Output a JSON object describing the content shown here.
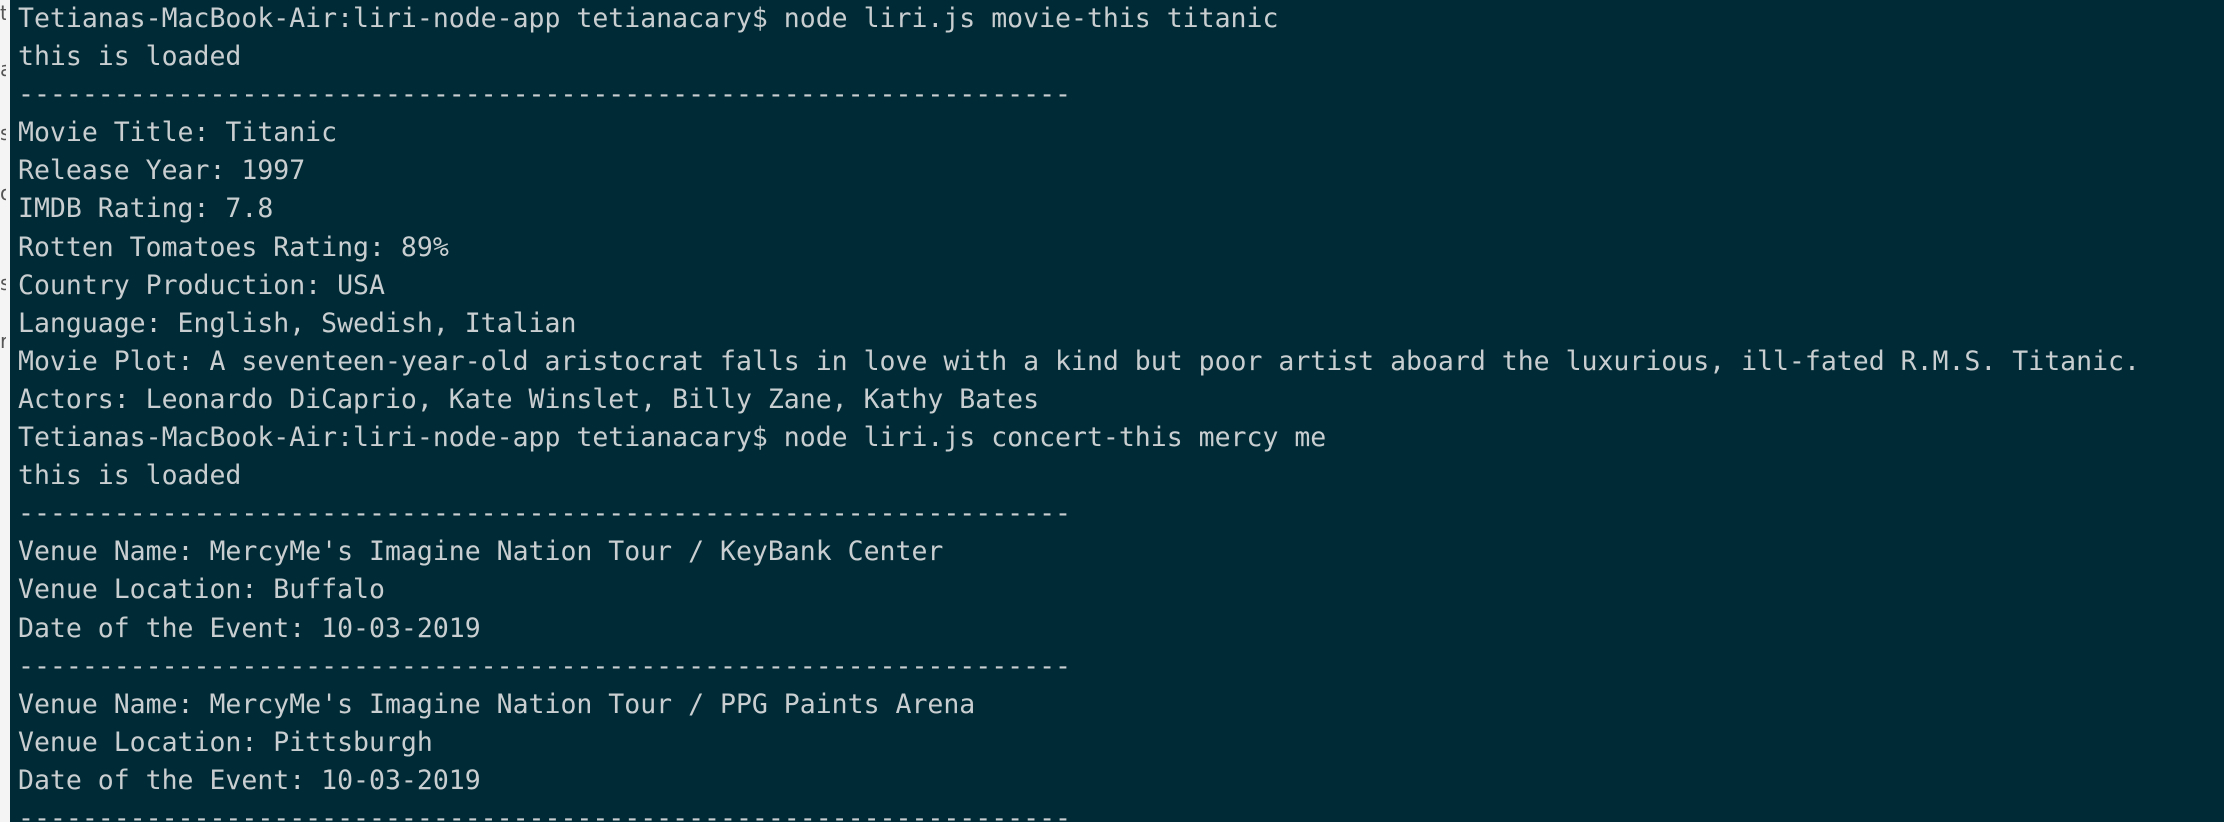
{
  "window": {
    "app": "Terminal",
    "background_color": "#002b36",
    "text_color": "#c9ced0"
  },
  "left_edge_fragments": [
    "t",
    "a",
    "s",
    "o",
    "s",
    "r"
  ],
  "terminal": {
    "lines": [
      "Tetianas-MacBook-Air:liri-node-app tetianacary$ node liri.js movie-this titanic",
      "this is loaded",
      "------------------------------------------------------------------",
      "Movie Title: Titanic",
      "Release Year: 1997",
      "IMDB Rating: 7.8",
      "Rotten Tomatoes Rating: 89%",
      "Country Production: USA",
      "Language: English, Swedish, Italian",
      "Movie Plot: A seventeen-year-old aristocrat falls in love with a kind but poor artist aboard the luxurious, ill-fated R.M.S. Titanic.",
      "Actors: Leonardo DiCaprio, Kate Winslet, Billy Zane, Kathy Bates",
      "Tetianas-MacBook-Air:liri-node-app tetianacary$ node liri.js concert-this mercy me",
      "this is loaded",
      "------------------------------------------------------------------",
      "Venue Name: MercyMe's Imagine Nation Tour / KeyBank Center",
      "Venue Location: Buffalo",
      "Date of the Event: 10-03-2019",
      "------------------------------------------------------------------",
      "Venue Name: MercyMe's Imagine Nation Tour / PPG Paints Arena",
      "Venue Location: Pittsburgh",
      "Date of the Event: 10-03-2019",
      "------------------------------------------------------------------"
    ]
  }
}
